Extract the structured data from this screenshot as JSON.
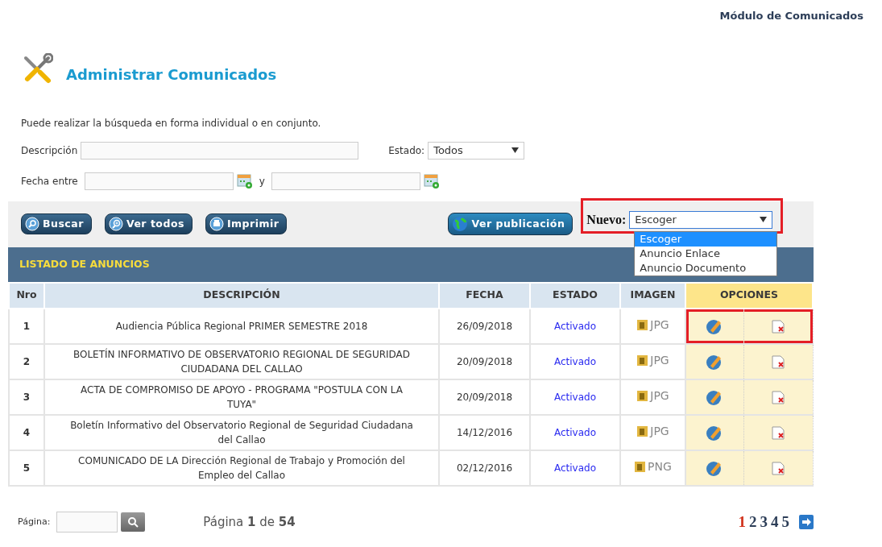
{
  "header": {
    "module_title": "Módulo de Comunicados"
  },
  "page_title": "Administrar Comunicados",
  "hint": "Puede realizar la búsqueda en forma individual o en conjunto.",
  "filters": {
    "description_label": "Descripción",
    "estado_label": "Estado:",
    "estado_value": "Todos",
    "date_label": "Fecha entre",
    "date_separator": "y"
  },
  "toolbar": {
    "buttons": [
      {
        "label": "Buscar",
        "kind": "search"
      },
      {
        "label": "Ver todos",
        "kind": "zoom"
      },
      {
        "label": "Imprimir",
        "kind": "print"
      }
    ],
    "publish_button": "Ver publicación",
    "nuevo": {
      "label": "Nuevo:",
      "value": "Escoger",
      "expanded": true,
      "highlighted": true,
      "options": [
        {
          "label": "Escoger",
          "selected": true
        },
        {
          "label": "Anuncio Enlace",
          "selected": false
        },
        {
          "label": "Anuncio Documento",
          "selected": false
        }
      ]
    }
  },
  "listing": {
    "title": "LISTADO DE ANUNCIOS",
    "columns": [
      "Nro",
      "DESCRIPCIÓN",
      "FECHA",
      "ESTADO",
      "IMAGEN",
      "OPCIONES"
    ],
    "rows": [
      {
        "nro": "1",
        "description": "Audiencia Pública Regional PRIMER SEMESTRE 2018",
        "date": "26/09/2018",
        "status": "Activado",
        "image": "JPG",
        "highlighted": true
      },
      {
        "nro": "2",
        "description": "BOLETÍN INFORMATIVO DE OBSERVATORIO REGIONAL DE SEGURIDAD CIUDADANA DEL CALLAO",
        "date": "20/09/2018",
        "status": "Activado",
        "image": "JPG",
        "highlighted": false
      },
      {
        "nro": "3",
        "description": "ACTA DE COMPROMISO DE APOYO - PROGRAMA \"POSTULA CON LA TUYA\"",
        "date": "20/09/2018",
        "status": "Activado",
        "image": "JPG",
        "highlighted": false
      },
      {
        "nro": "4",
        "description": "Boletín Informativo del Observatorio Regional de Seguridad Ciudadana del Callao",
        "date": "14/12/2016",
        "status": "Activado",
        "image": "JPG",
        "highlighted": false
      },
      {
        "nro": "5",
        "description": "COMUNICADO DE LA Dirección Regional de Trabajo y Promoción del Empleo del Callao",
        "date": "02/12/2016",
        "status": "Activado",
        "image": "PNG",
        "highlighted": false
      }
    ]
  },
  "pager": {
    "goto_label": "Página:",
    "summary": "Página **1** de **54**",
    "pages": [
      {
        "label": "1",
        "selected": true
      },
      {
        "label": "2",
        "selected": false
      },
      {
        "label": "3",
        "selected": false
      },
      {
        "label": "4",
        "selected": false
      },
      {
        "label": "5",
        "selected": false
      }
    ]
  }
}
